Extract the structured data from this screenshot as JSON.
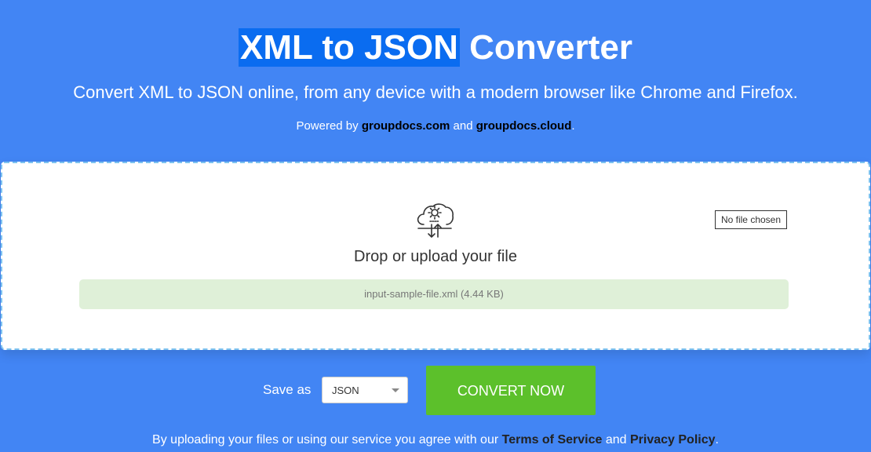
{
  "header": {
    "title_highlight": "XML to JSON",
    "title_rest": " Converter",
    "subtitle": "Convert XML to JSON online, from any device with a modern browser like Chrome and Firefox.",
    "powered_prefix": "Powered by ",
    "powered_link1": "groupdocs.com",
    "powered_and": " and ",
    "powered_link2": "groupdocs.cloud",
    "powered_suffix": "."
  },
  "upload": {
    "icon": "cloud-settings-icon",
    "no_file_label": "No file chosen",
    "drop_text": "Drop or upload your file",
    "file_name": "input-sample-file.xml (4.44 KB)"
  },
  "controls": {
    "save_as_label": "Save as",
    "format_selected": "JSON",
    "convert_label": "CONVERT NOW"
  },
  "footer": {
    "prefix": "By uploading your files or using our service you agree with our ",
    "terms": "Terms of Service",
    "and": " and ",
    "privacy": "Privacy Policy",
    "suffix": "."
  },
  "colors": {
    "background": "#4285f4",
    "convert_button": "#5cc02b",
    "file_bar": "#dff0d8",
    "dropzone_border": "#7ec3f0"
  }
}
